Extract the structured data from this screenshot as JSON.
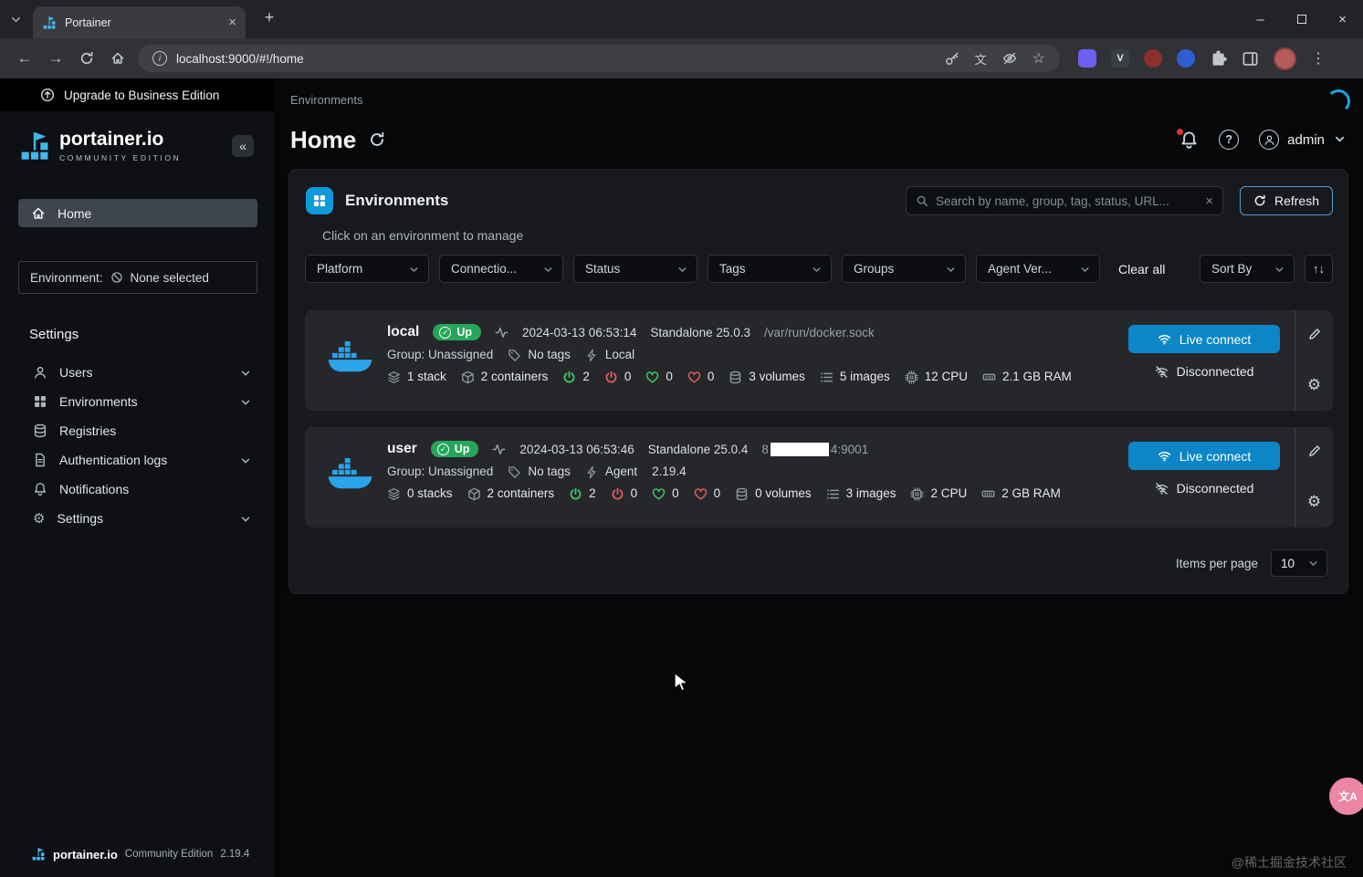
{
  "browser": {
    "tab_title": "Portainer",
    "url": "localhost:9000/#!/home",
    "extension_v_label": "V"
  },
  "icons": {
    "collapse": "«",
    "check": "✓",
    "close": "×",
    "new_tab": "+",
    "back": "←",
    "forward": "→",
    "minimize": "–",
    "bookmark_star": "☆",
    "sort_arrows": "↑↓",
    "gear": "⚙",
    "kebab": "⋮",
    "info": "i",
    "question": "?",
    "translate": "文",
    "fab": "文A"
  },
  "banner": {
    "text": "Upgrade to Business Edition"
  },
  "sidebar": {
    "logo_title": "portainer.io",
    "logo_subtitle": "COMMUNITY EDITION",
    "home_label": "Home",
    "environment_label": "Environment:",
    "environment_value": "None selected",
    "section_title": "Settings",
    "items": [
      {
        "label": "Users"
      },
      {
        "label": "Environments"
      },
      {
        "label": "Registries"
      },
      {
        "label": "Authentication logs"
      },
      {
        "label": "Notifications"
      },
      {
        "label": "Settings"
      }
    ],
    "footer": {
      "brand": "portainer.io",
      "edition": "Community Edition",
      "version": "2.19.4"
    }
  },
  "header": {
    "breadcrumb": "Environments",
    "title": "Home",
    "user": "admin"
  },
  "panel": {
    "title": "Environments",
    "hint": "Click on an environment to manage",
    "search_placeholder": "Search by name, group, tag, status, URL...",
    "refresh_label": "Refresh",
    "filters": [
      "Platform",
      "Connectio...",
      "Status",
      "Tags",
      "Groups",
      "Agent Ver..."
    ],
    "clear_all": "Clear all",
    "sort_by": "Sort By",
    "items_per_page_label": "Items per page",
    "items_per_page_value": "10"
  },
  "environments": [
    {
      "name": "local",
      "status": "Up",
      "timestamp": "2024-03-13 06:53:14",
      "engine": "Standalone 25.0.3",
      "url": "/var/run/docker.sock",
      "group": "Group: Unassigned",
      "tags": "No tags",
      "connection": "Local",
      "stacks": "1 stack",
      "containers": "2 containers",
      "running": "2",
      "stopped": "0",
      "healthy": "0",
      "unhealthy": "0",
      "volumes": "3 volumes",
      "images": "5 images",
      "cpu": "12 CPU",
      "ram": "2.1 GB RAM",
      "connect_label": "Live connect",
      "connection_status": "Disconnected"
    },
    {
      "name": "user",
      "status": "Up",
      "timestamp": "2024-03-13 06:53:46",
      "engine": "Standalone 25.0.4",
      "url_prefix": "8",
      "url_suffix": "4:9001",
      "group": "Group: Unassigned",
      "tags": "No tags",
      "connection": "Agent",
      "agent_version": "2.19.4",
      "stacks": "0 stacks",
      "containers": "2 containers",
      "running": "2",
      "stopped": "0",
      "healthy": "0",
      "unhealthy": "0",
      "volumes": "0 volumes",
      "images": "3 images",
      "cpu": "2 CPU",
      "ram": "2 GB RAM",
      "connect_label": "Live connect",
      "connection_status": "Disconnected"
    }
  ],
  "watermark": "@稀土掘金技术社区",
  "colors": {
    "accent_blue": "#0c86c6",
    "portainer_blue": "#41b9ea",
    "badge_green": "#26a65b",
    "running_green": "#41c769",
    "stopped_red": "#e25c5c",
    "panel_bg": "#17191d",
    "card_bg": "#25272b",
    "fab_pink": "#ed85a5"
  }
}
